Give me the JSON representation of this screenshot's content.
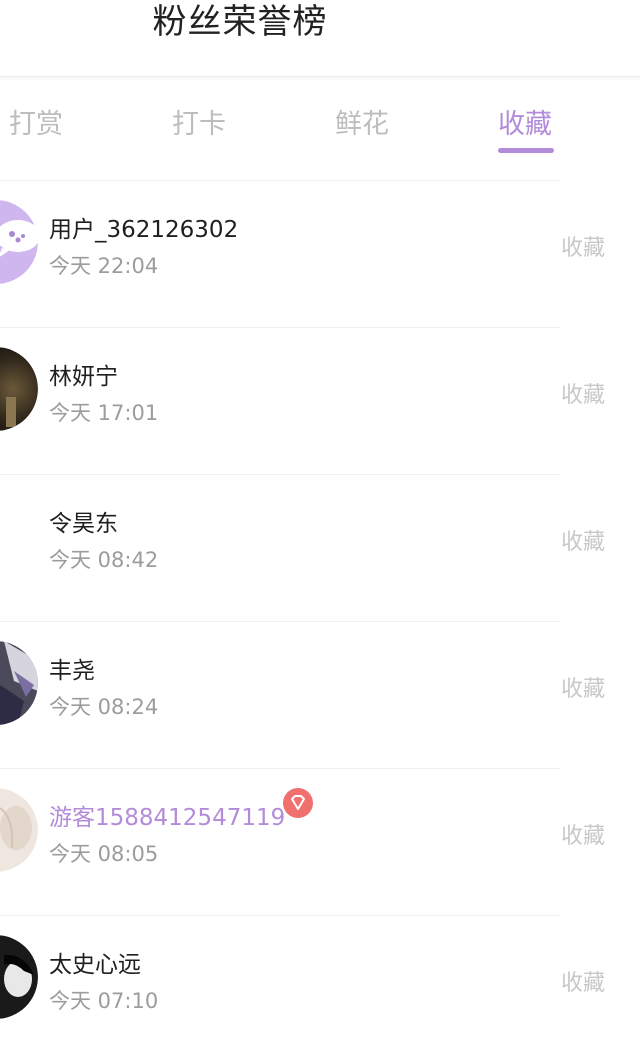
{
  "header": {
    "title": "粉丝荣誉榜"
  },
  "tabs": [
    {
      "label": "打赏"
    },
    {
      "label": "打卡"
    },
    {
      "label": "鲜花"
    },
    {
      "label": "收藏",
      "active": true
    }
  ],
  "users": [
    {
      "name": "用户_362126302",
      "time": "今天 22:04",
      "action": "收藏"
    },
    {
      "name": "林妍宁",
      "time": "今天 17:01",
      "action": "收藏"
    },
    {
      "name": "令昊东",
      "time": "今天 08:42",
      "action": "收藏"
    },
    {
      "name": "丰尧",
      "time": "今天 08:24",
      "action": "收藏"
    },
    {
      "name": "游客1588412547119",
      "time": "今天 08:05",
      "action": "收藏"
    },
    {
      "name": "太史心远",
      "time": "今天 07:10",
      "action": "收藏"
    }
  ],
  "colors": {
    "accent": "#b38cd9",
    "inactive_tab": "#bdbdbd",
    "badge": "#f06f6f"
  },
  "icons": {
    "chat_avatar": "chat-bubble-avatar-icon",
    "badge": "gem-icon"
  }
}
